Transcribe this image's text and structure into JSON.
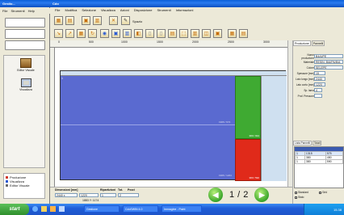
{
  "outer_window": {
    "title": "Gestio...",
    "menu": [
      "File",
      "Strumenti",
      "Help"
    ],
    "side_items": [
      {
        "label": "Editor Visuale",
        "icon": "editor-icon"
      },
      {
        "label": "Visualizza",
        "icon": "monitor-icon"
      }
    ],
    "bottom_items": [
      {
        "label": "Produzione",
        "color": "#d23a2a"
      },
      {
        "label": "Visualizza",
        "color": "#2a5ad2"
      },
      {
        "label": "Editor Visuale",
        "color": "#6a6a6a"
      }
    ]
  },
  "main_window": {
    "title": "Cdo",
    "menu": [
      "File",
      "Modifica",
      "Selezione",
      "Visualizza",
      "Azioni",
      "Disposizione",
      "Strumenti",
      "Informazioni"
    ],
    "toolbar_label": "Spazio",
    "ruler_labels": [
      "0",
      "500",
      "1000",
      "1500",
      "2000",
      "2500",
      "3000"
    ]
  },
  "sheet": {
    "region_labels": {
      "blue_main": "1906 / 674",
      "blue_bottom": "1906 / 1224",
      "green": "380 / 934",
      "red": "380 / 590",
      "corner": "1"
    }
  },
  "status_bar": {
    "headers": [
      "Dimensioni [mm]",
      "Ripartizioni",
      "Tot.",
      "Pezzi"
    ],
    "values": [
      "2440 x",
      "1220",
      "1",
      "2"
    ],
    "coords": "1883 Y: 1174"
  },
  "pager": {
    "current": "1",
    "separator": "/",
    "total": "2"
  },
  "right_panel": {
    "tabs": [
      "Produzione",
      "Pannelli"
    ],
    "fields": [
      {
        "label": "Nome produzione",
        "value": "B4/A/PE"
      },
      {
        "label": "Materiale",
        "value": "RESIN. BIA/PA/B/A"
      },
      {
        "label": "Colore",
        "value": "SELEPE"
      },
      {
        "label": "Spessore [mm]",
        "value": "15"
      },
      {
        "label": "Lato lungo [mm]",
        "value": "2440"
      },
      {
        "label": "Lato corto [mm]",
        "value": "1220"
      },
      {
        "label": "Sp. lama",
        "value": "4"
      },
      {
        "label": "Prof. Pressore",
        "value": ""
      }
    ],
    "list_tabs": [
      "Lista Pannelli",
      "Totali"
    ],
    "table_rows": [
      {
        "n": "1",
        "a": "1315",
        "b": "575"
      },
      {
        "n": "1",
        "a": "380",
        "b": "450"
      },
      {
        "n": "1",
        "a": "380",
        "b": "590"
      }
    ],
    "checkboxes": [
      "Standard",
      "Grid",
      "Stato"
    ]
  },
  "taskbar": {
    "start": "start",
    "items": [
      "Gestione",
      "CdoSWIN 4.0",
      "Immagine - Paint"
    ],
    "clock": "15.38"
  }
}
